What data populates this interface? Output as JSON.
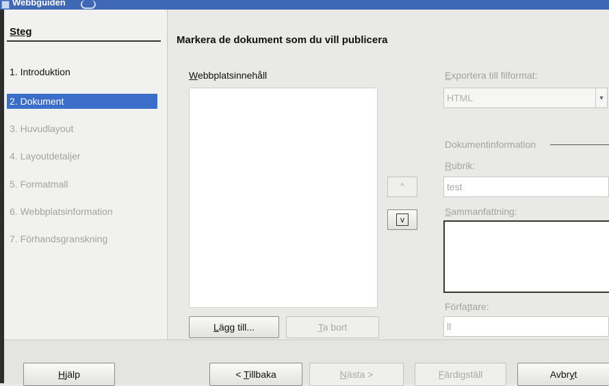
{
  "window": {
    "title": "Webbguiden"
  },
  "sidebar": {
    "heading": "Steg",
    "steps": [
      {
        "label": "1. Introduktion",
        "state": "normal"
      },
      {
        "label": "2. Dokument",
        "state": "active"
      },
      {
        "label": "3. Huvudlayout",
        "state": "disabled"
      },
      {
        "label": "4. Layoutdetaljer",
        "state": "disabled"
      },
      {
        "label": "5. Formatmall",
        "state": "disabled"
      },
      {
        "label": "6. Webbplatsinformation",
        "state": "disabled"
      },
      {
        "label": "7. Förhandsgranskning",
        "state": "disabled"
      }
    ]
  },
  "main": {
    "heading": "Markera de dokument som du vill publicera",
    "content_list_label": {
      "mnemonic": "W",
      "rest": "ebbplatsinnehåll"
    },
    "add_button": {
      "mnemonic": "L",
      "rest": "ägg till..."
    },
    "remove_button": {
      "mnemonic": "T",
      "rest": "a bort"
    },
    "move_up_glyph": "^",
    "move_down_glyph": "v",
    "export_label": {
      "mnemonic": "E",
      "rest": "xportera till filformat:"
    },
    "export_format": "HTML",
    "doc_info_heading": "Dokumentinformation",
    "title_label": {
      "mnemonic": "R",
      "rest": "ubrik:"
    },
    "title_value": "test",
    "summary_label": {
      "mnemonic": "S",
      "rest": "ammanfattning:"
    },
    "author_label": {
      "before": "Förfa",
      "mnemonic": "t",
      "after": "tare:"
    },
    "author_value": "ll"
  },
  "footer": {
    "help": {
      "mnemonic": "H",
      "rest": "jälp"
    },
    "back": {
      "before": "< ",
      "mnemonic": "T",
      "after": "illbaka"
    },
    "next": {
      "mnemonic": "N",
      "rest": "ästa >"
    },
    "finish": {
      "mnemonic": "F",
      "rest": "ärdigställ"
    },
    "cancel": {
      "before": "Avbr",
      "mnemonic": "y",
      "after": "t"
    }
  },
  "colors": {
    "selection": "#3a6ec8",
    "titlebar": "#3f68b4",
    "disabled_text": "#a2a2a0"
  }
}
